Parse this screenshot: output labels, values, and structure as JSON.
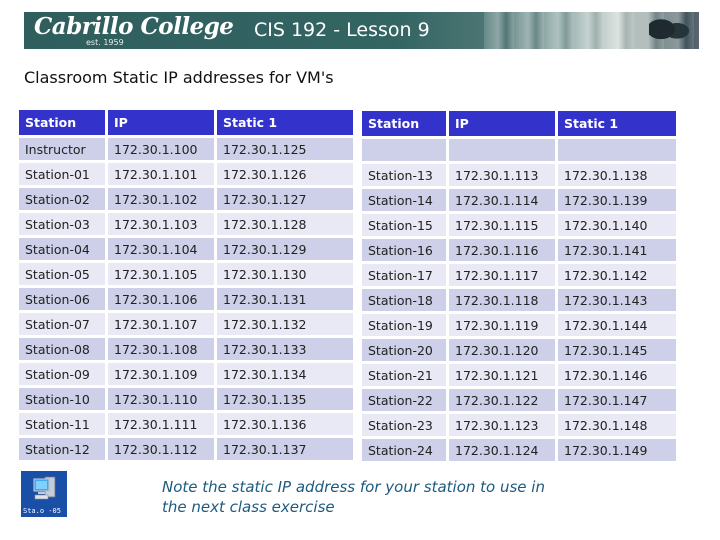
{
  "header": {
    "logo_text": "Cabrillo College",
    "logo_est": "est. 1959",
    "title": "CIS 192 - Lesson 9"
  },
  "subtitle": "Classroom Static IP addresses for VM's",
  "colors": {
    "header_bg": "#3333cc",
    "row_dark": "#cdd0e8",
    "row_light": "#e8e9f4",
    "note_text": "#1e5a80",
    "banner": "#336563"
  },
  "left_table": {
    "headers": [
      "Station",
      "IP",
      "Static 1"
    ],
    "rows": [
      [
        "Instructor",
        "172.30.1.100",
        "172.30.1.125"
      ],
      [
        "Station-01",
        "172.30.1.101",
        "172.30.1.126"
      ],
      [
        "Station-02",
        "172.30.1.102",
        "172.30.1.127"
      ],
      [
        "Station-03",
        "172.30.1.103",
        "172.30.1.128"
      ],
      [
        "Station-04",
        "172.30.1.104",
        "172.30.1.129"
      ],
      [
        "Station-05",
        "172.30.1.105",
        "172.30.1.130"
      ],
      [
        "Station-06",
        "172.30.1.106",
        "172.30.1.131"
      ],
      [
        "Station-07",
        "172.30.1.107",
        "172.30.1.132"
      ],
      [
        "Station-08",
        "172.30.1.108",
        "172.30.1.133"
      ],
      [
        "Station-09",
        "172.30.1.109",
        "172.30.1.134"
      ],
      [
        "Station-10",
        "172.30.1.110",
        "172.30.1.135"
      ],
      [
        "Station-11",
        "172.30.1.111",
        "172.30.1.136"
      ],
      [
        "Station-12",
        "172.30.1.112",
        "172.30.1.137"
      ]
    ]
  },
  "right_table": {
    "headers": [
      "Station",
      "IP",
      "Static 1"
    ],
    "rows": [
      [
        "",
        "",
        ""
      ],
      [
        "Station-13",
        "172.30.1.113",
        "172.30.1.138"
      ],
      [
        "Station-14",
        "172.30.1.114",
        "172.30.1.139"
      ],
      [
        "Station-15",
        "172.30.1.115",
        "172.30.1.140"
      ],
      [
        "Station-16",
        "172.30.1.116",
        "172.30.1.141"
      ],
      [
        "Station-17",
        "172.30.1.117",
        "172.30.1.142"
      ],
      [
        "Station-18",
        "172.30.1.118",
        "172.30.1.143"
      ],
      [
        "Station-19",
        "172.30.1.119",
        "172.30.1.144"
      ],
      [
        "Station-20",
        "172.30.1.120",
        "172.30.1.145"
      ],
      [
        "Station-21",
        "172.30.1.121",
        "172.30.1.146"
      ],
      [
        "Station-22",
        "172.30.1.122",
        "172.30.1.147"
      ],
      [
        "Station-23",
        "172.30.1.123",
        "172.30.1.148"
      ],
      [
        "Station-24",
        "172.30.1.124",
        "172.30.1.149"
      ]
    ]
  },
  "station_icon": {
    "icon": "computer-icon",
    "label": "Sta.o -05"
  },
  "note": "Note the static IP address for your station to use in the next class exercise"
}
